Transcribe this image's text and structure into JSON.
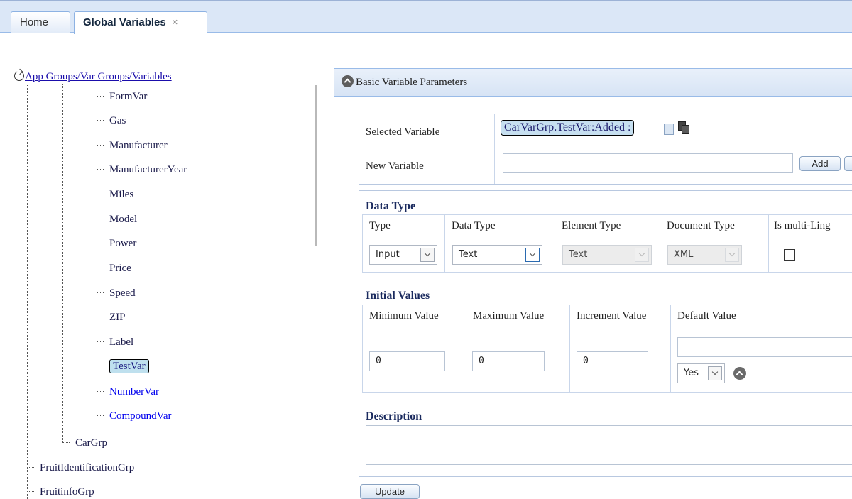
{
  "tabs": {
    "home": "Home",
    "active": "Global Variables",
    "close": "×"
  },
  "tree": {
    "root": "App Groups/Var Groups/Variables",
    "items": [
      {
        "label": "FormVar",
        "style": "dark"
      },
      {
        "label": "Gas",
        "style": "dark"
      },
      {
        "label": "Manufacturer",
        "style": "dark"
      },
      {
        "label": "ManufacturerYear",
        "style": "dark"
      },
      {
        "label": "Miles",
        "style": "dark"
      },
      {
        "label": "Model",
        "style": "dark"
      },
      {
        "label": "Power",
        "style": "dark"
      },
      {
        "label": "Price",
        "style": "dark"
      },
      {
        "label": "Speed",
        "style": "dark"
      },
      {
        "label": "ZIP",
        "style": "dark"
      },
      {
        "label": "Label",
        "style": "dark"
      },
      {
        "label": "TestVar",
        "style": "selected"
      },
      {
        "label": "NumberVar",
        "style": "blue"
      },
      {
        "label": "CompoundVar",
        "style": "blue"
      }
    ],
    "group": "CarGrp",
    "top_groups": [
      "FruitIdentificationGrp",
      "FruitinfoGrp"
    ]
  },
  "panel": {
    "title": "Basic Variable Parameters",
    "selected_variable_label": "Selected Variable",
    "selected_variable_value": "CarVarGrp.TestVar:Added :",
    "new_variable_label": "New Variable",
    "new_variable_value": "",
    "add_button": "Add",
    "data_type_section": "Data Type",
    "columns": {
      "type": "Type",
      "data_type": "Data Type",
      "element_type": "Element Type",
      "document_type": "Document Type",
      "multi_lingual": "Is multi-Ling"
    },
    "values": {
      "type": "Input",
      "data_type": "Text",
      "element_type": "Text",
      "document_type": "XML",
      "multi_lingual_checked": false
    },
    "initial_values_section": "Initial Values",
    "initial_columns": {
      "min": "Minimum Value",
      "max": "Maximum Value",
      "inc": "Increment Value",
      "default": "Default Value"
    },
    "initial_values": {
      "min": "0",
      "max": "0",
      "inc": "0",
      "default": "",
      "default_select": "Yes"
    },
    "description_section": "Description",
    "description_value": "",
    "update_button": "Update"
  },
  "colors": {
    "tab_bar": "#dbe7f7",
    "panel_header": "#d7e4f5",
    "selected_node": "#bfe0ee",
    "link": "#1a0dab"
  }
}
